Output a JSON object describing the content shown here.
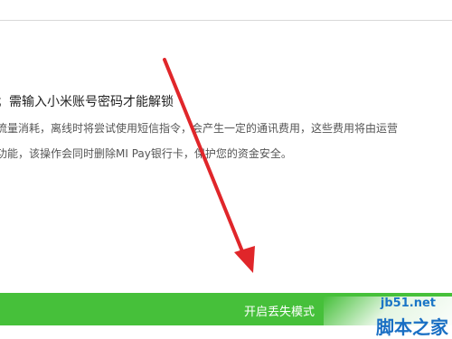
{
  "lost_mode": {
    "warning": "；需输入小米账号密码才能解锁",
    "description_line1": "流量消耗，离线时将尝试使用短信指令，会产生一定的通讯费用，这些费用将由运营",
    "description_line2": "功能，该操作会同时删除MI Pay银行卡，保护您的资金安全。",
    "enable_button_label": "开启丢失模式"
  },
  "watermark": {
    "domain": "jb51.net",
    "site_name": "脚本之家"
  },
  "colors": {
    "action_green": "#46c03a",
    "annotation_arrow": "#e0262a",
    "watermark_blue": "#1a6fc4"
  }
}
